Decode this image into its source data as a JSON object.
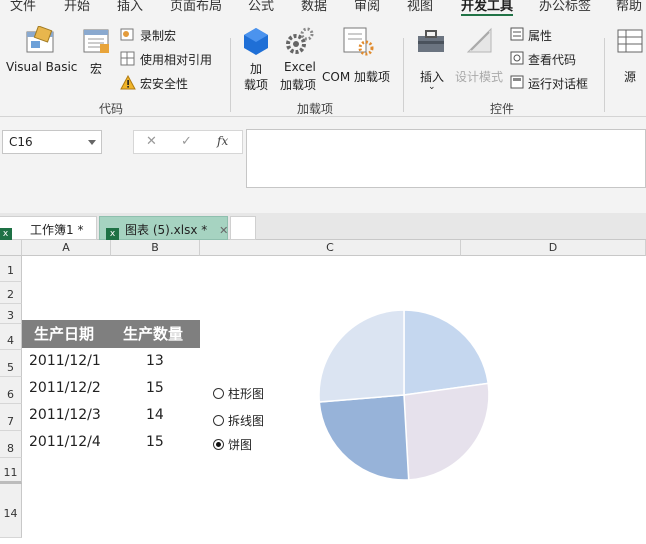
{
  "ribbon_tabs": [
    "文件",
    "开始",
    "插入",
    "页面布局",
    "公式",
    "数据",
    "审阅",
    "视图",
    "开发工具",
    "办公标签",
    "帮助"
  ],
  "active_tab": "开发工具",
  "groups": {
    "code": {
      "label": "代码",
      "visual_basic": "Visual Basic",
      "macros": "宏",
      "record_macro": "录制宏",
      "relative_refs": "使用相对引用",
      "macro_security": "宏安全性"
    },
    "addins": {
      "label": "加载项",
      "addins": "加\n载项",
      "excel_addins": "Excel\n加载项",
      "com_addins": "COM 加载项"
    },
    "controls": {
      "label": "控件",
      "insert": "插入",
      "design_mode": "设计模式",
      "properties": "属性",
      "view_code": "查看代码",
      "run_dialog": "运行对话框"
    },
    "xml": {
      "source": "源"
    }
  },
  "formula_bar": {
    "name_box": "C16",
    "cancel": "✕",
    "enter": "✓",
    "fx": "fx",
    "content": ""
  },
  "workbook_tabs": [
    {
      "label": "工作簿1 *",
      "active": false
    },
    {
      "label": "图表 (5).xlsx *",
      "active": true,
      "close": "✕"
    }
  ],
  "columns": [
    "A",
    "B",
    "C",
    "D"
  ],
  "rows": [
    "1",
    "2",
    "3",
    "4",
    "5",
    "6",
    "7",
    "8",
    "11",
    "14"
  ],
  "table": {
    "headers": [
      "生产日期",
      "生产数量"
    ],
    "rows": [
      [
        "2011/12/1",
        "13"
      ],
      [
        "2011/12/2",
        "15"
      ],
      [
        "2011/12/3",
        "14"
      ],
      [
        "2011/12/4",
        "15"
      ]
    ]
  },
  "chart_options": [
    {
      "label": "柱形图",
      "selected": false
    },
    {
      "label": "拆线图",
      "selected": false
    },
    {
      "label": "饼图",
      "selected": true
    }
  ],
  "chart_data": {
    "type": "pie",
    "categories": [
      "2011/12/1",
      "2011/12/2",
      "2011/12/3",
      "2011/12/4"
    ],
    "values": [
      13,
      15,
      14,
      15
    ],
    "colors": [
      "#c5d7ef",
      "#e6e1ec",
      "#97b3d9",
      "#dbe4f2"
    ]
  },
  "colors": {
    "accent": "#217346",
    "header_fill": "#7f7f7f",
    "active_workbook_tab": "#a6d3c1"
  }
}
